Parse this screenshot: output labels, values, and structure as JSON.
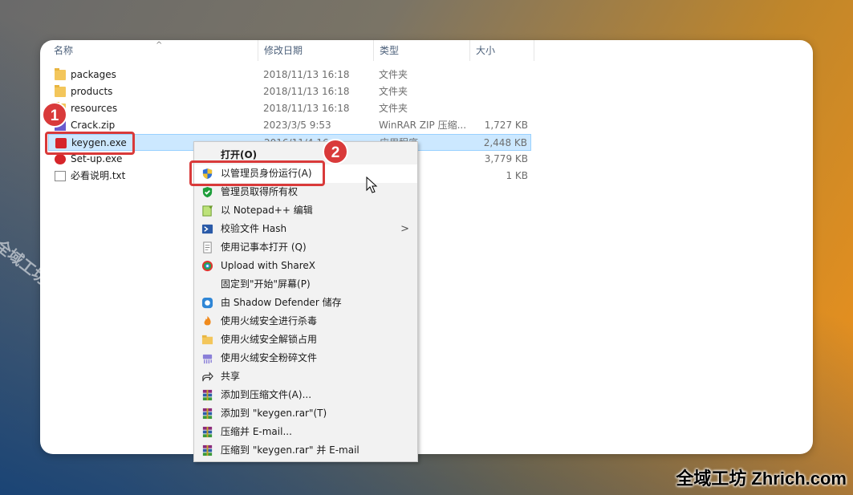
{
  "columns": {
    "name": "名称",
    "date": "修改日期",
    "type": "类型",
    "size": "大小",
    "sort_icon": "^"
  },
  "files": [
    {
      "name": "packages",
      "date": "2018/11/13 16:18",
      "type": "文件夹",
      "size": "",
      "icon": "folder-icon"
    },
    {
      "name": "products",
      "date": "2018/11/13 16:18",
      "type": "文件夹",
      "size": "",
      "icon": "folder-icon"
    },
    {
      "name": "resources",
      "date": "2018/11/13 16:18",
      "type": "文件夹",
      "size": "",
      "icon": "folder-icon"
    },
    {
      "name": "Crack.zip",
      "date": "2023/3/5 9:53",
      "type": "WinRAR ZIP 压缩...",
      "size": "1,727 KB",
      "icon": "zip-archive-icon"
    },
    {
      "name": "keygen.exe",
      "date": "2016/11/4 16:...",
      "type": "应用程序",
      "size": "2,448 KB",
      "icon": "exe-app-icon"
    },
    {
      "name": "Set-up.exe",
      "date": "",
      "type": "",
      "size": "3,779 KB",
      "icon": "setup-app-icon"
    },
    {
      "name": "必看说明.txt",
      "date": "",
      "type": "",
      "size": "1 KB",
      "icon": "text-file-icon"
    }
  ],
  "context_menu": [
    {
      "label": "打开(O)",
      "icon": "",
      "bold": true
    },
    {
      "label": "以管理员身份运行(A)",
      "icon": "uac-shield-icon",
      "hover": true
    },
    {
      "label": "管理员取得所有权",
      "icon": "green-shield-icon"
    },
    {
      "label": "以 Notepad++ 编辑",
      "icon": "notepadpp-icon"
    },
    {
      "label": "校验文件 Hash",
      "icon": "powershell-icon",
      "submenu": true
    },
    {
      "label": "使用记事本打开 (Q)",
      "icon": "notepad-icon"
    },
    {
      "label": "Upload with ShareX",
      "icon": "sharex-icon"
    },
    {
      "label": "固定到\"开始\"屏幕(P)",
      "icon": ""
    },
    {
      "label": "由 Shadow Defender 储存",
      "icon": "shadow-defender-icon"
    },
    {
      "label": "使用火绒安全进行杀毒",
      "icon": "huorong-icon"
    },
    {
      "label": "使用火绒安全解锁占用",
      "icon": "folder-unlock-icon"
    },
    {
      "label": "使用火绒安全粉碎文件",
      "icon": "shredder-icon"
    },
    {
      "label": "共享",
      "icon": "share-icon"
    },
    {
      "label": "添加到压缩文件(A)...",
      "icon": "winrar-icon"
    },
    {
      "label": "添加到 \"keygen.rar\"(T)",
      "icon": "winrar-icon"
    },
    {
      "label": "压缩并 E-mail...",
      "icon": "winrar-icon"
    },
    {
      "label": "压缩到 \"keygen.rar\" 并 E-mail",
      "icon": "winrar-icon"
    }
  ],
  "submenu_arrow": ">",
  "annotations": {
    "step1": "1",
    "step2": "2"
  },
  "watermarks": {
    "diagonal": "全域工坊 zhrich.com",
    "corner": "全域工坊 Zhrich.com"
  },
  "colors": {
    "highlight": "#d93a3a",
    "selection": "#cce8ff"
  }
}
